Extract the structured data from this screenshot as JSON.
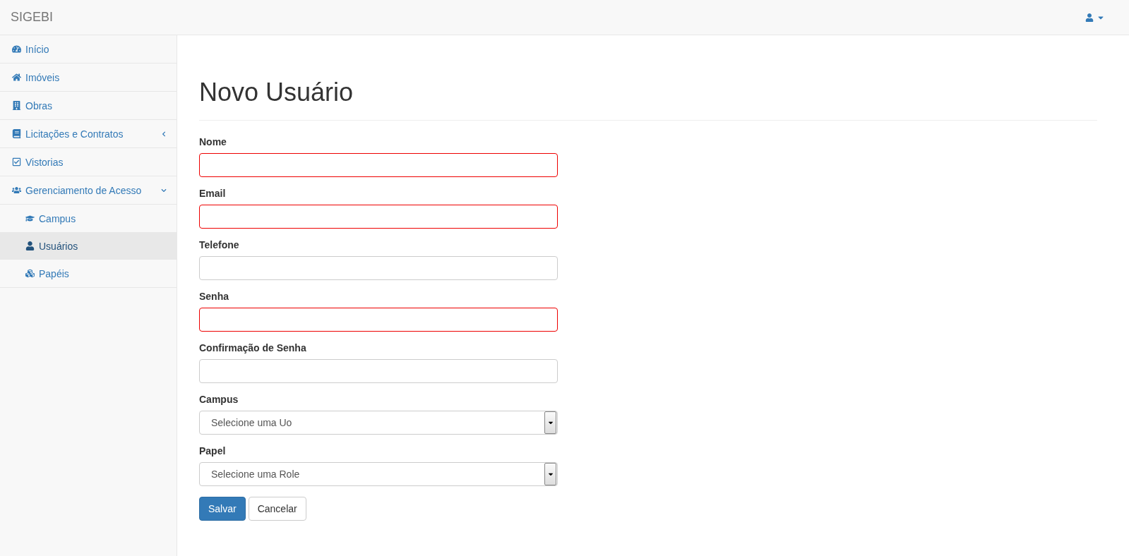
{
  "brand": "SIGEBI",
  "sidebar": {
    "items": [
      {
        "label": "Início",
        "selected": false
      },
      {
        "label": "Imóveis",
        "selected": false
      },
      {
        "label": "Obras",
        "selected": false
      },
      {
        "label": "Licitações e Contratos",
        "selected": false,
        "expanded": false
      },
      {
        "label": "Vistorias",
        "selected": false
      },
      {
        "label": "Gerenciamento de Acesso",
        "selected": false,
        "expanded": true,
        "children": [
          {
            "label": "Campus",
            "selected": false
          },
          {
            "label": "Usuários",
            "selected": true
          },
          {
            "label": "Papéis",
            "selected": false
          }
        ]
      }
    ]
  },
  "page_title": "Novo Usuário",
  "form": {
    "fields": [
      {
        "kind": "text",
        "label": "Nome",
        "invalid": true
      },
      {
        "kind": "text",
        "label": "Email",
        "invalid": true
      },
      {
        "kind": "text",
        "label": "Telefone",
        "invalid": false
      },
      {
        "kind": "password",
        "label": "Senha",
        "invalid": true
      },
      {
        "kind": "password",
        "label": "Confirmação de Senha",
        "invalid": false
      },
      {
        "kind": "select",
        "label": "Campus",
        "value": "Selecione uma Uo",
        "invalid": false
      },
      {
        "kind": "select",
        "label": "Papel",
        "value": "Selecione uma Role",
        "invalid": false
      }
    ],
    "buttons": [
      {
        "label": "Salvar",
        "kind": "primary"
      },
      {
        "label": "Cancelar",
        "kind": "default"
      }
    ]
  }
}
